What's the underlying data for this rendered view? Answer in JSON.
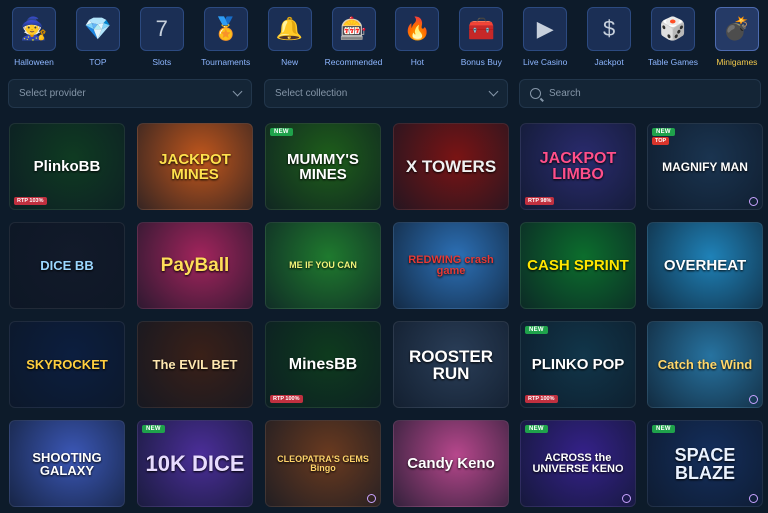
{
  "categories": [
    {
      "label": "Halloween",
      "icon": "witch-hat-icon",
      "glyph": "🧙",
      "active": false
    },
    {
      "label": "TOP",
      "icon": "diamond-icon",
      "glyph": "💎",
      "active": false
    },
    {
      "label": "Slots",
      "icon": "seven-icon",
      "glyph": "7",
      "active": false
    },
    {
      "label": "Tournaments",
      "icon": "medal-icon",
      "glyph": "🏅",
      "active": false
    },
    {
      "label": "New",
      "icon": "bell-icon",
      "glyph": "🔔",
      "active": false
    },
    {
      "label": "Recommended",
      "icon": "slot-machine-icon",
      "glyph": "🎰",
      "active": false
    },
    {
      "label": "Hot",
      "icon": "fire-icon",
      "glyph": "🔥",
      "active": false
    },
    {
      "label": "Bonus Buy",
      "icon": "treasure-chest-icon",
      "glyph": "🧰",
      "active": false
    },
    {
      "label": "Live Casino",
      "icon": "play-icon",
      "glyph": "▶",
      "active": false
    },
    {
      "label": "Jackpot",
      "icon": "dollar-icon",
      "glyph": "$",
      "active": false
    },
    {
      "label": "Table Games",
      "icon": "dice-icon",
      "glyph": "🎲",
      "active": false
    },
    {
      "label": "Minigames",
      "icon": "bomb-icon",
      "glyph": "💣",
      "active": true
    }
  ],
  "filters": {
    "provider_placeholder": "Select provider",
    "collection_placeholder": "Select collection",
    "search_placeholder": "Search"
  },
  "games": [
    {
      "title": "PlinkoBB",
      "bg": "#0f3b22",
      "fg": "#ffffff",
      "size": 15,
      "badge": "",
      "rtp": "RTP 103%",
      "info": false
    },
    {
      "title": "JACKPOT MINES",
      "bg": "#c0561c",
      "fg": "#ffe14d",
      "size": 15,
      "badge": "",
      "rtp": "",
      "info": false
    },
    {
      "title": "MUMMY'S MINES",
      "bg": "#1e5e1a",
      "fg": "#ffffff",
      "size": 15,
      "badge": "NEW",
      "rtp": "",
      "info": false
    },
    {
      "title": "X TOWERS",
      "bg": "#7a1414",
      "fg": "#f1f1f1",
      "size": 17,
      "badge": "",
      "rtp": "",
      "info": false
    },
    {
      "title": "JACKPOT LIMBO",
      "bg": "#2a2b6e",
      "fg": "#ff4f8a",
      "size": 16,
      "badge": "",
      "rtp": "RTP 98%",
      "info": false
    },
    {
      "title": "MAGNIFY MAN",
      "bg": "#1a3450",
      "fg": "#ffffff",
      "size": 12,
      "badge": "NEW",
      "badge2": "TOP",
      "rtp": "",
      "info": true
    },
    {
      "title": "DICE BB",
      "bg": "#121a2a",
      "fg": "#9bd7ff",
      "size": 13,
      "badge": "",
      "rtp": "",
      "info": false
    },
    {
      "title": "PayBall",
      "bg": "#a2245c",
      "fg": "#ffde59",
      "size": 19,
      "badge": "",
      "rtp": "",
      "info": false
    },
    {
      "title": "ME IF YOU CAN",
      "bg": "#1f7a2e",
      "fg": "#f1f57a",
      "size": 9,
      "badge": "",
      "rtp": "",
      "info": false
    },
    {
      "title": "REDWING crash game",
      "bg": "#2c70b6",
      "fg": "#e53935",
      "size": 11,
      "badge": "",
      "rtp": "",
      "info": false
    },
    {
      "title": "CASH SPRINT",
      "bg": "#0c6e2d",
      "fg": "#ffe600",
      "size": 15,
      "badge": "",
      "rtp": "",
      "info": false
    },
    {
      "title": "OVERHEAT",
      "bg": "#1f82b8",
      "fg": "#ffffff",
      "size": 15,
      "badge": "",
      "rtp": "",
      "info": false
    },
    {
      "title": "SKYROCKET",
      "bg": "#0c1e3f",
      "fg": "#ffcf3f",
      "size": 13,
      "badge": "",
      "rtp": "",
      "info": false
    },
    {
      "title": "The EVIL BET",
      "bg": "#3a2018",
      "fg": "#ffe7b0",
      "size": 13,
      "badge": "",
      "rtp": "",
      "info": false
    },
    {
      "title": "MinesBB",
      "bg": "#0e3b1e",
      "fg": "#ffffff",
      "size": 16,
      "badge": "",
      "rtp": "RTP 100%",
      "info": false
    },
    {
      "title": "ROOSTER RUN",
      "bg": "#2a3e58",
      "fg": "#ffffff",
      "size": 17,
      "badge": "",
      "rtp": "",
      "info": false
    },
    {
      "title": "PLINKO POP",
      "bg": "#11364a",
      "fg": "#ffffff",
      "size": 15,
      "badge": "NEW",
      "rtp": "RTP 100%",
      "info": false
    },
    {
      "title": "Catch the Wind",
      "bg": "#2773a0",
      "fg": "#ffd76b",
      "size": 13,
      "badge": "",
      "rtp": "",
      "info": true
    },
    {
      "title": "SHOOTING GALAXY",
      "bg": "#3b57b6",
      "fg": "#ffffff",
      "size": 13,
      "badge": "",
      "rtp": "",
      "info": false
    },
    {
      "title": "10K DICE",
      "bg": "#4b2e99",
      "fg": "#e8dcff",
      "size": 22,
      "badge": "NEW",
      "rtp": "",
      "info": false
    },
    {
      "title": "CLEOPATRA'S GEMS Bingo",
      "bg": "#6a3a1f",
      "fg": "#ffd36a",
      "size": 9,
      "badge": "",
      "rtp": "",
      "info": true
    },
    {
      "title": "Candy Keno",
      "bg": "#b7478c",
      "fg": "#ffffff",
      "size": 15,
      "badge": "",
      "rtp": "",
      "info": false
    },
    {
      "title": "ACROSS the UNIVERSE KENO",
      "bg": "#35218a",
      "fg": "#ffffff",
      "size": 11,
      "badge": "NEW",
      "rtp": "",
      "info": true
    },
    {
      "title": "SPACE BLAZE",
      "bg": "#142e5c",
      "fg": "#eaf2ff",
      "size": 18,
      "badge": "NEW",
      "rtp": "",
      "info": true
    }
  ]
}
